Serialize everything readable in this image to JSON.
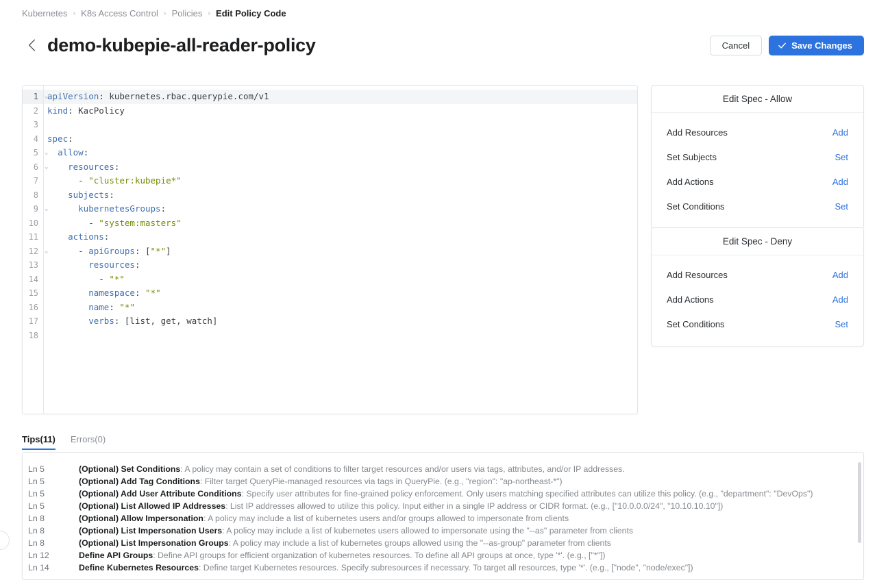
{
  "breadcrumb": {
    "items": [
      {
        "label": "Kubernetes"
      },
      {
        "label": "K8s Access Control"
      },
      {
        "label": "Policies"
      },
      {
        "label": "Edit Policy Code"
      }
    ],
    "separator": "›"
  },
  "header": {
    "back_icon": "chevron-left-icon",
    "title": "demo-kubepie-all-reader-policy",
    "cancel_label": "Cancel",
    "save_label": "Save Changes",
    "save_icon": "check-icon",
    "accent_color": "#2c73e0"
  },
  "editor": {
    "active_line": 1,
    "total_lines": 18,
    "fold_lines": [
      1,
      5,
      6,
      9,
      12
    ],
    "fold_glyph": "⌄",
    "lines": [
      {
        "n": 1,
        "tokens": [
          {
            "t": "key",
            "v": "apiVersion"
          },
          {
            "t": "plain",
            "v": ": kubernetes.rbac.querypie.com/v1"
          }
        ]
      },
      {
        "n": 2,
        "tokens": [
          {
            "t": "key",
            "v": "kind"
          },
          {
            "t": "plain",
            "v": ": KacPolicy"
          }
        ]
      },
      {
        "n": 3,
        "tokens": []
      },
      {
        "n": 4,
        "tokens": [
          {
            "t": "key",
            "v": "spec"
          },
          {
            "t": "plain",
            "v": ":"
          }
        ]
      },
      {
        "n": 5,
        "tokens": [
          {
            "t": "plain",
            "v": "  "
          },
          {
            "t": "key",
            "v": "allow"
          },
          {
            "t": "plain",
            "v": ":"
          }
        ]
      },
      {
        "n": 6,
        "tokens": [
          {
            "t": "plain",
            "v": "    "
          },
          {
            "t": "key",
            "v": "resources"
          },
          {
            "t": "plain",
            "v": ":"
          }
        ]
      },
      {
        "n": 7,
        "tokens": [
          {
            "t": "plain",
            "v": "      - "
          },
          {
            "t": "str",
            "v": "\"cluster:kubepie*\""
          }
        ]
      },
      {
        "n": 8,
        "tokens": [
          {
            "t": "plain",
            "v": "    "
          },
          {
            "t": "key",
            "v": "subjects"
          },
          {
            "t": "plain",
            "v": ":"
          }
        ]
      },
      {
        "n": 9,
        "tokens": [
          {
            "t": "plain",
            "v": "      "
          },
          {
            "t": "key",
            "v": "kubernetesGroups"
          },
          {
            "t": "plain",
            "v": ":"
          }
        ]
      },
      {
        "n": 10,
        "tokens": [
          {
            "t": "plain",
            "v": "        - "
          },
          {
            "t": "str",
            "v": "\"system:masters\""
          }
        ]
      },
      {
        "n": 11,
        "tokens": [
          {
            "t": "plain",
            "v": "    "
          },
          {
            "t": "key",
            "v": "actions"
          },
          {
            "t": "plain",
            "v": ":"
          }
        ]
      },
      {
        "n": 12,
        "tokens": [
          {
            "t": "plain",
            "v": "      - "
          },
          {
            "t": "key",
            "v": "apiGroups"
          },
          {
            "t": "plain",
            "v": ": ["
          },
          {
            "t": "str",
            "v": "\"*\""
          },
          {
            "t": "plain",
            "v": "]"
          }
        ]
      },
      {
        "n": 13,
        "tokens": [
          {
            "t": "plain",
            "v": "        "
          },
          {
            "t": "key",
            "v": "resources"
          },
          {
            "t": "plain",
            "v": ":"
          }
        ]
      },
      {
        "n": 14,
        "tokens": [
          {
            "t": "plain",
            "v": "          - "
          },
          {
            "t": "str",
            "v": "\"*\""
          }
        ]
      },
      {
        "n": 15,
        "tokens": [
          {
            "t": "plain",
            "v": "        "
          },
          {
            "t": "key",
            "v": "namespace"
          },
          {
            "t": "plain",
            "v": ": "
          },
          {
            "t": "str",
            "v": "\"*\""
          }
        ]
      },
      {
        "n": 16,
        "tokens": [
          {
            "t": "plain",
            "v": "        "
          },
          {
            "t": "key",
            "v": "name"
          },
          {
            "t": "plain",
            "v": ": "
          },
          {
            "t": "str",
            "v": "\"*\""
          }
        ]
      },
      {
        "n": 17,
        "tokens": [
          {
            "t": "plain",
            "v": "        "
          },
          {
            "t": "key",
            "v": "verbs"
          },
          {
            "t": "plain",
            "v": ": [list, get, watch]"
          }
        ]
      },
      {
        "n": 18,
        "tokens": []
      }
    ]
  },
  "spec_panels": [
    {
      "id": "allow",
      "title": "Edit Spec - Allow",
      "rows": [
        {
          "label": "Add Resources",
          "action": "Add"
        },
        {
          "label": "Set Subjects",
          "action": "Set"
        },
        {
          "label": "Add Actions",
          "action": "Add"
        },
        {
          "label": "Set Conditions",
          "action": "Set"
        }
      ]
    },
    {
      "id": "deny",
      "title": "Edit Spec - Deny",
      "rows": [
        {
          "label": "Add Resources",
          "action": "Add"
        },
        {
          "label": "Add Actions",
          "action": "Add"
        },
        {
          "label": "Set Conditions",
          "action": "Set"
        }
      ]
    }
  ],
  "tabs": [
    {
      "label": "Tips(11)",
      "active": true
    },
    {
      "label": "Errors(0)",
      "active": false
    }
  ],
  "tips": [
    {
      "line": "Ln 5",
      "title": "(Optional) Set Conditions",
      "desc": ": A policy may contain a set of conditions to filter target resources and/or users via tags, attributes, and/or IP addresses."
    },
    {
      "line": "Ln 5",
      "title": "(Optional) Add Tag Conditions",
      "desc": ": Filter target QueryPie-managed resources via tags in QueryPie. (e.g., \"region\": \"ap-northeast-*\")"
    },
    {
      "line": "Ln 5",
      "title": "(Optional) Add User Attribute Conditions",
      "desc": ": Specify user attributes for fine-grained policy enforcement. Only users matching specified attributes can utilize this policy. (e.g., \"department\": \"DevOps\")"
    },
    {
      "line": "Ln 5",
      "title": "(Optional) List Allowed IP Addresses",
      "desc": ": List IP addresses allowed to utilize this policy. Input either in a single IP address or CIDR format. (e.g., [\"10.0.0.0/24\", \"10.10.10.10\"])"
    },
    {
      "line": "Ln 8",
      "title": "(Optional) Allow Impersonation",
      "desc": ": A policy may include a list of kubernetes users and/or groups allowed to impersonate from clients"
    },
    {
      "line": "Ln 8",
      "title": "(Optional) List Impersonation Users",
      "desc": ": A policy may include a list of kubernetes users allowed to impersonate using the \"--as\" parameter from clients"
    },
    {
      "line": "Ln 8",
      "title": "(Optional) List Impersonation Groups",
      "desc": ": A policy may include a list of kubernetes groups allowed using the \"--as-group\" parameter from clients"
    },
    {
      "line": "Ln 12",
      "title": "Define API Groups",
      "desc": ": Define API groups for efficient organization of kubernetes resources. To define all API groups at once, type '*'. (e.g., [\"*\"])"
    },
    {
      "line": "Ln 14",
      "title": "Define Kubernetes Resources",
      "desc": ": Define target Kubernetes resources. Specify subresources if necessary. To target all resources, type '*'. (e.g., [\"node\", \"node/exec\"])"
    }
  ]
}
